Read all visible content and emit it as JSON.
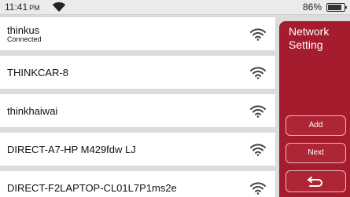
{
  "status": {
    "time": "11:41",
    "ampm": "PM",
    "battery": "86%",
    "battery_level": 0.86
  },
  "networks": [
    {
      "ssid": "thinkus",
      "status": "Connected"
    },
    {
      "ssid": "THINKCAR-8",
      "status": ""
    },
    {
      "ssid": "thinkhaiwai",
      "status": ""
    },
    {
      "ssid": "DIRECT-A7-HP M429fdw LJ",
      "status": ""
    },
    {
      "ssid": "DIRECT-F2LAPTOP-CL01L7P1ms2e",
      "status": ""
    }
  ],
  "panel": {
    "title": "Network\nSetting",
    "add_label": "Add",
    "next_label": "Next"
  },
  "icons": {
    "status_wifi": "wifi-icon",
    "network_wifi": "wifi-icon",
    "battery": "battery-icon",
    "back": "back-arrow-icon"
  },
  "colors": {
    "accent": "#a51c2e",
    "background": "#dcdcdc",
    "row": "#ffffff"
  }
}
